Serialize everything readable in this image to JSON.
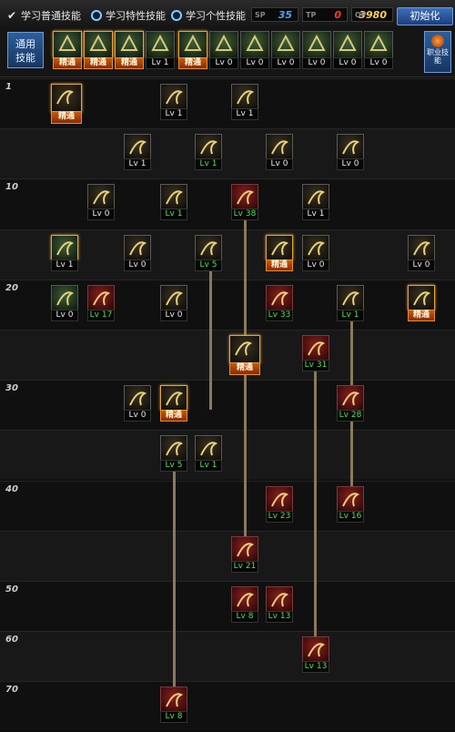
{
  "topbar": {
    "mode_general": "学习普通技能",
    "mode_trait": "学习特性技能",
    "mode_personal": "学习个性技能",
    "counter_sp_label": "SP",
    "counter_sp_value": "35",
    "counter_tp_label": "TP",
    "counter_tp_value": "0",
    "counter_qp_label": "QP",
    "counter_qp_value": "3980",
    "reset_label": "初始化"
  },
  "hotbar": {
    "common_label_1": "通用",
    "common_label_2": "技能",
    "skilltab_label": "职业技能",
    "slots": [
      "精通",
      "精通",
      "精通",
      "Lv 1",
      "精通",
      "Lv 0",
      "Lv 0",
      "Lv 0",
      "Lv 0",
      "Lv 0",
      "Lv 0"
    ]
  },
  "levels": [
    "1",
    "10",
    "20",
    "30",
    "40",
    "50",
    "60",
    "70"
  ],
  "skills": {
    "r1a": "精通",
    "r1b": "Lv 1",
    "r1c": "Lv 1",
    "r2a": "Lv 1",
    "r2b": "Lv 1",
    "r2c": "Lv 0",
    "r2d": "Lv 0",
    "r3a": "Lv 0",
    "r3b": "Lv 1",
    "r3c": "Lv 38",
    "r3d": "Lv 1",
    "r4a": "Lv 1",
    "r4b": "Lv 0",
    "r4c": "Lv 5",
    "r4d": "精通",
    "r4e": "Lv 0",
    "r4f": "Lv 0",
    "r5a": "Lv 0",
    "r5b": "Lv 17",
    "r5c": "Lv 0",
    "r5d": "Lv 33",
    "r5e": "Lv 1",
    "r5f": "精通",
    "r6a": "精通",
    "r6b": "Lv 31",
    "r7a": "Lv 0",
    "r7b": "精通",
    "r7c": "Lv 28",
    "r8a": "Lv 5",
    "r8b": "Lv 1",
    "r9a": "Lv 23",
    "r9b": "Lv 16",
    "r10a": "Lv 21",
    "r11a": "Lv 8",
    "r11b": "Lv 13",
    "r12a": "Lv 13",
    "r13a": "Lv 8"
  }
}
